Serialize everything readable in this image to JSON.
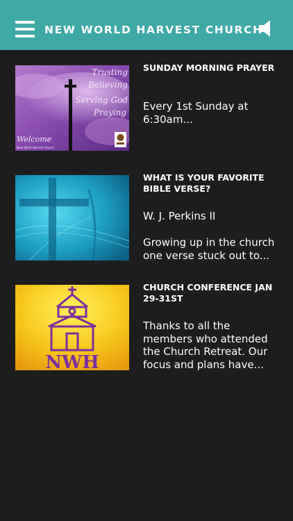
{
  "header": {
    "title": "NEW WORLD HARVEST CHURCH",
    "menu_icon": "hamburger-menu-icon",
    "speaker_icon": "speaker-icon",
    "bar_color": "#3fa9a6"
  },
  "feed": {
    "items": [
      {
        "title": "SUNDAY MORNING PRAYER",
        "body": "Every 1st Sunday at\n6:30am...",
        "image": {
          "lines": [
            "Trusting",
            "Believing",
            "Serving God",
            "Praying"
          ],
          "welcome": "Welcome",
          "caption": "New World Harvest Church"
        }
      },
      {
        "title": "WHAT IS YOUR FAVORITE BIBLE VERSE?",
        "author": "W. J. Perkins II",
        "body": "Growing up in the church\none verse stuck out to..."
      },
      {
        "title": "CHURCH CONFERENCE JAN 29-31ST",
        "body": "Thanks to all the\nmembers who attended\nthe Church Retreat. Our\nfocus and plans have...",
        "image": {
          "logo_text": "NWH"
        }
      }
    ]
  }
}
